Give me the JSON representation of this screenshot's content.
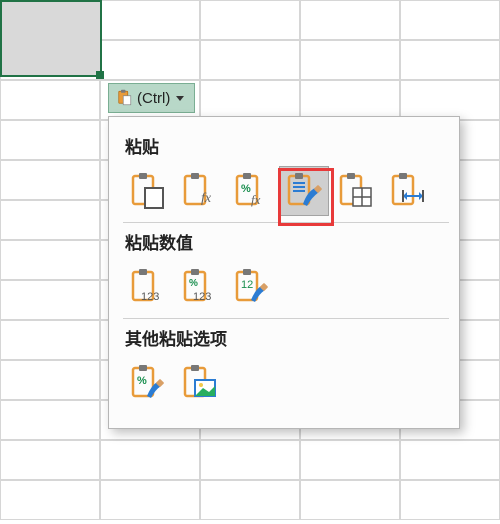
{
  "ctrl_button": {
    "label": "(Ctrl)"
  },
  "sections": {
    "paste": {
      "title": "粘贴"
    },
    "values": {
      "title": "粘贴数值"
    },
    "other": {
      "title": "其他粘贴选项"
    }
  },
  "options": {
    "paste": "paste-normal",
    "paste_formulas": "paste-formulas",
    "paste_formulas_number": "paste-formulas-number-formatting",
    "paste_keep_source": "paste-keep-source-formatting",
    "paste_no_borders": "paste-no-borders",
    "paste_keep_col_width": "paste-keep-source-column-widths",
    "values": "paste-values",
    "values_number": "paste-values-number-formatting",
    "values_source": "paste-values-source-formatting",
    "formatting": "paste-formatting",
    "picture": "paste-as-picture"
  }
}
